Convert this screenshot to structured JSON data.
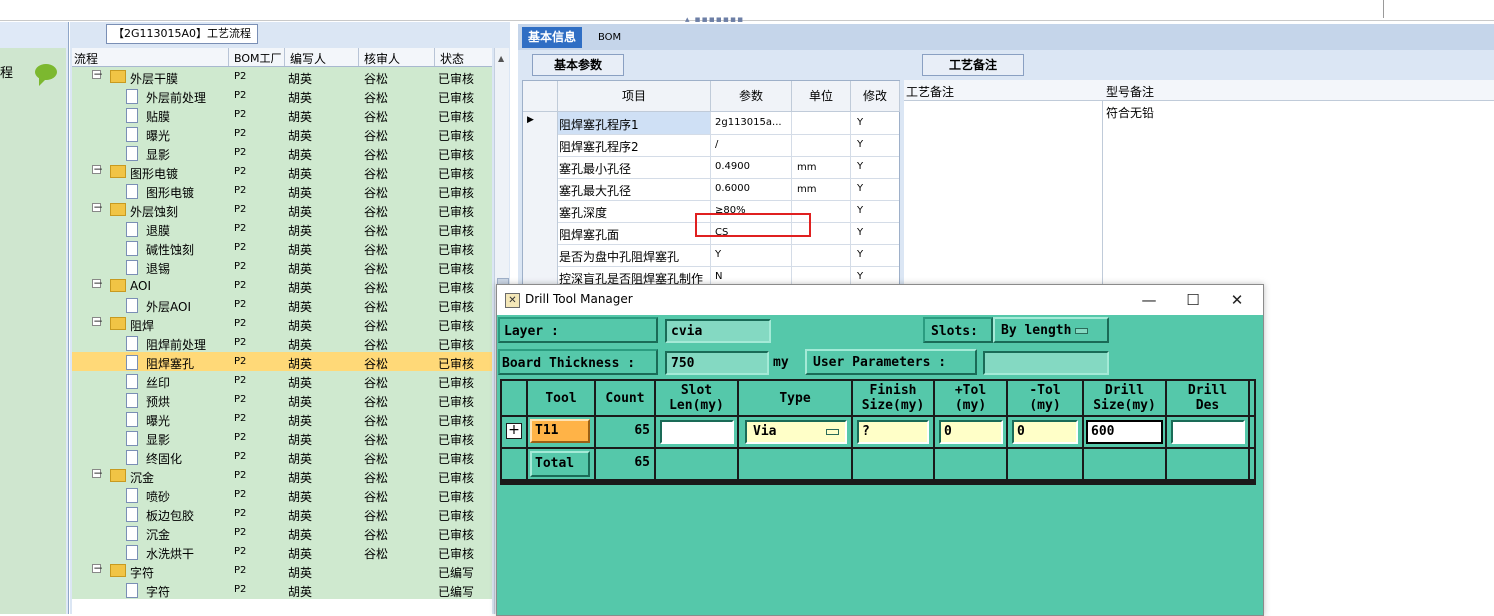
{
  "colors": {
    "accent": "#2f6ec4",
    "tree_row": "#cfe9cf",
    "tree_selected": "#ffd978",
    "dialog_bg": "#55c8aa",
    "highlight_box": "#e02020"
  },
  "left_panel": {
    "label": "程"
  },
  "tree": {
    "title": "【2G113015A0】工艺流程",
    "columns": [
      "流程",
      "BOM工厂",
      "编写人",
      "核审人",
      "状态"
    ],
    "rows": [
      {
        "name": "外层干膜",
        "type": "folder",
        "bom": "P2",
        "writer": "胡英",
        "reviewer": "谷松",
        "status": "已审核"
      },
      {
        "name": "外层前处理",
        "type": "doc",
        "bom": "P2",
        "writer": "胡英",
        "reviewer": "谷松",
        "status": "已审核"
      },
      {
        "name": "贴膜",
        "type": "doc",
        "bom": "P2",
        "writer": "胡英",
        "reviewer": "谷松",
        "status": "已审核"
      },
      {
        "name": "曝光",
        "type": "doc",
        "bom": "P2",
        "writer": "胡英",
        "reviewer": "谷松",
        "status": "已审核"
      },
      {
        "name": "显影",
        "type": "doc",
        "bom": "P2",
        "writer": "胡英",
        "reviewer": "谷松",
        "status": "已审核"
      },
      {
        "name": "图形电镀",
        "type": "folder",
        "bom": "P2",
        "writer": "胡英",
        "reviewer": "谷松",
        "status": "已审核"
      },
      {
        "name": "图形电镀",
        "type": "doc",
        "bom": "P2",
        "writer": "胡英",
        "reviewer": "谷松",
        "status": "已审核"
      },
      {
        "name": "外层蚀刻",
        "type": "folder",
        "bom": "P2",
        "writer": "胡英",
        "reviewer": "谷松",
        "status": "已审核"
      },
      {
        "name": "退膜",
        "type": "doc",
        "bom": "P2",
        "writer": "胡英",
        "reviewer": "谷松",
        "status": "已审核"
      },
      {
        "name": "碱性蚀刻",
        "type": "doc",
        "bom": "P2",
        "writer": "胡英",
        "reviewer": "谷松",
        "status": "已审核"
      },
      {
        "name": "退锡",
        "type": "doc",
        "bom": "P2",
        "writer": "胡英",
        "reviewer": "谷松",
        "status": "已审核"
      },
      {
        "name": "AOI",
        "type": "folder",
        "bom": "P2",
        "writer": "胡英",
        "reviewer": "谷松",
        "status": "已审核"
      },
      {
        "name": "外层AOI",
        "type": "doc",
        "bom": "P2",
        "writer": "胡英",
        "reviewer": "谷松",
        "status": "已审核"
      },
      {
        "name": "阻焊",
        "type": "folder",
        "bom": "P2",
        "writer": "胡英",
        "reviewer": "谷松",
        "status": "已审核"
      },
      {
        "name": "阻焊前处理",
        "type": "doc",
        "bom": "P2",
        "writer": "胡英",
        "reviewer": "谷松",
        "status": "已审核"
      },
      {
        "name": "阻焊塞孔",
        "type": "doc",
        "bom": "P2",
        "writer": "胡英",
        "reviewer": "谷松",
        "status": "已审核",
        "selected": true
      },
      {
        "name": "丝印",
        "type": "doc",
        "bom": "P2",
        "writer": "胡英",
        "reviewer": "谷松",
        "status": "已审核"
      },
      {
        "name": "预烘",
        "type": "doc",
        "bom": "P2",
        "writer": "胡英",
        "reviewer": "谷松",
        "status": "已审核"
      },
      {
        "name": "曝光",
        "type": "doc",
        "bom": "P2",
        "writer": "胡英",
        "reviewer": "谷松",
        "status": "已审核"
      },
      {
        "name": "显影",
        "type": "doc",
        "bom": "P2",
        "writer": "胡英",
        "reviewer": "谷松",
        "status": "已审核"
      },
      {
        "name": "终固化",
        "type": "doc",
        "bom": "P2",
        "writer": "胡英",
        "reviewer": "谷松",
        "status": "已审核"
      },
      {
        "name": "沉金",
        "type": "folder",
        "bom": "P2",
        "writer": "胡英",
        "reviewer": "谷松",
        "status": "已审核"
      },
      {
        "name": "喷砂",
        "type": "doc",
        "bom": "P2",
        "writer": "胡英",
        "reviewer": "谷松",
        "status": "已审核"
      },
      {
        "name": "板边包胶",
        "type": "doc",
        "bom": "P2",
        "writer": "胡英",
        "reviewer": "谷松",
        "status": "已审核"
      },
      {
        "name": "沉金",
        "type": "doc",
        "bom": "P2",
        "writer": "胡英",
        "reviewer": "谷松",
        "status": "已审核"
      },
      {
        "name": "水洗烘干",
        "type": "doc",
        "bom": "P2",
        "writer": "胡英",
        "reviewer": "谷松",
        "status": "已审核"
      },
      {
        "name": "字符",
        "type": "folder",
        "bom": "P2",
        "writer": "胡英",
        "reviewer": "",
        "status": "已编写"
      },
      {
        "name": "字符",
        "type": "doc",
        "bom": "P2",
        "writer": "胡英",
        "reviewer": "",
        "status": "已编写"
      }
    ]
  },
  "info": {
    "tabs": [
      "基本信息",
      "BOM"
    ],
    "subtab": "基本参数",
    "grid_columns": [
      "项目",
      "参数",
      "单位",
      "修改"
    ],
    "grid_rows": [
      {
        "item": "阻焊塞孔程序1",
        "param": "2g113015a...",
        "unit": "",
        "mod": "Y"
      },
      {
        "item": "阻焊塞孔程序2",
        "param": "/",
        "unit": "",
        "mod": "Y"
      },
      {
        "item": "塞孔最小孔径",
        "param": "0.4900",
        "unit": "mm",
        "mod": "Y"
      },
      {
        "item": "塞孔最大孔径",
        "param": "0.6000",
        "unit": "mm",
        "mod": "Y"
      },
      {
        "item": "塞孔深度",
        "param": "≥80%",
        "unit": "",
        "mod": "Y"
      },
      {
        "item": "阻焊塞孔面",
        "param": "CS",
        "unit": "",
        "mod": "Y"
      },
      {
        "item": "是否为盘中孔阻焊塞孔",
        "param": "Y",
        "unit": "",
        "mod": "Y"
      },
      {
        "item": "控深盲孔是否阻焊塞孔制作",
        "param": "N",
        "unit": "",
        "mod": "Y"
      }
    ],
    "notes_tab": "工艺备注",
    "notes_columns": [
      "工艺备注",
      "型号备注"
    ],
    "model_note": "符合无铅"
  },
  "dialog": {
    "title": "Drill Tool Manager",
    "layer_label": "Layer        :",
    "layer_value": "cvia",
    "slots_label": "Slots:",
    "slots_value": "By length",
    "thickness_label": "Board Thickness  :",
    "thickness_value": "750",
    "thickness_unit": "my",
    "user_params_label": "User Parameters :",
    "user_params_value": "",
    "columns": [
      "Tool",
      "Count",
      "Slot\nLen(my)",
      "Type",
      "Finish\nSize(my)",
      "+Tol\n(my)",
      "-Tol\n(my)",
      "Drill\nSize(my)",
      "Drill\nDes"
    ],
    "tool_row": {
      "tool": "T11",
      "count": "65",
      "slot_len": "",
      "type": "Via",
      "finish_size": "?",
      "plus_tol": "0",
      "minus_tol": "0",
      "drill_size": "600",
      "drill_des": ""
    },
    "total_row": {
      "label": "Total",
      "count": "65"
    }
  }
}
